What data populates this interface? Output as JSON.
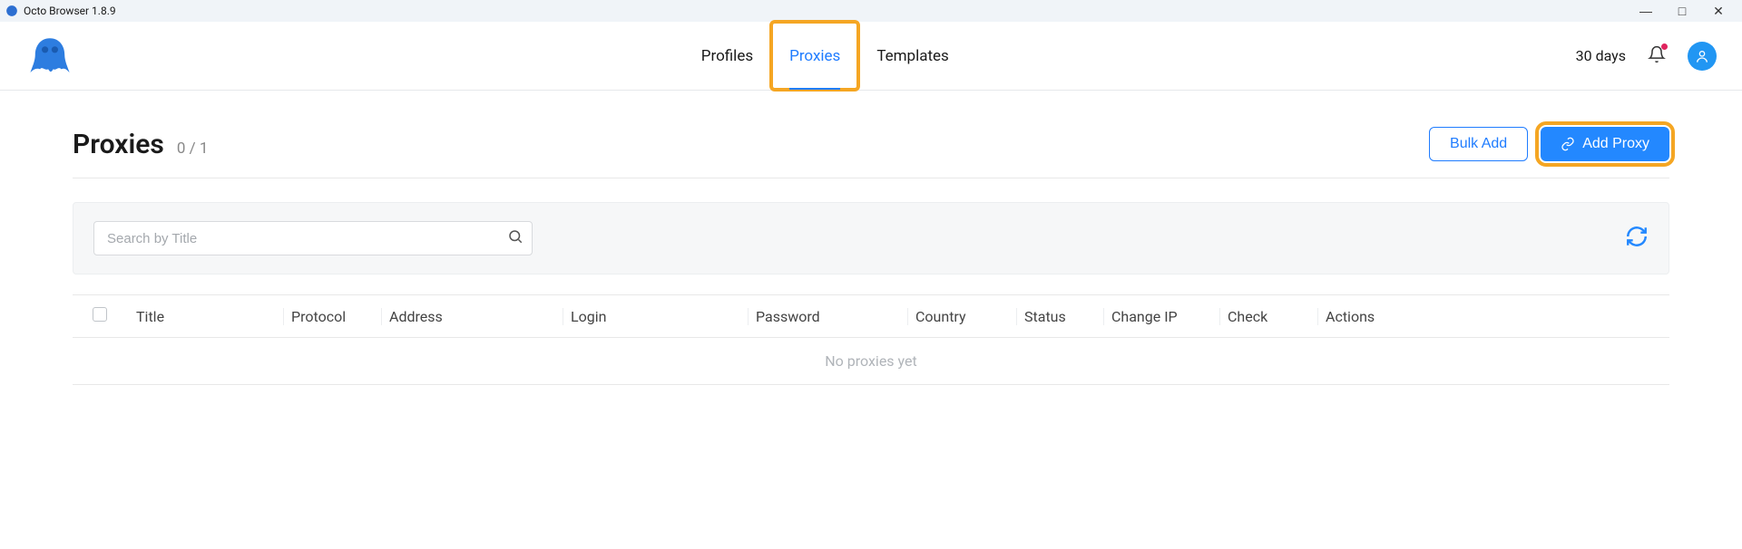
{
  "window": {
    "title": "Octo Browser 1.8.9"
  },
  "header": {
    "tabs": [
      {
        "label": "Profiles",
        "active": false
      },
      {
        "label": "Proxies",
        "active": true
      },
      {
        "label": "Templates",
        "active": false
      }
    ],
    "days_label": "30 days"
  },
  "page": {
    "title": "Proxies",
    "count": "0 / 1",
    "bulk_add_label": "Bulk Add",
    "add_proxy_label": "Add Proxy"
  },
  "search": {
    "placeholder": "Search by Title",
    "value": ""
  },
  "table": {
    "columns": {
      "title": "Title",
      "protocol": "Protocol",
      "address": "Address",
      "login": "Login",
      "password": "Password",
      "country": "Country",
      "status": "Status",
      "change_ip": "Change IP",
      "check": "Check",
      "actions": "Actions"
    },
    "empty_message": "No proxies yet",
    "rows": []
  },
  "colors": {
    "accent": "#2388ff",
    "highlight": "#f5a623",
    "notification_dot": "#e0245e"
  }
}
